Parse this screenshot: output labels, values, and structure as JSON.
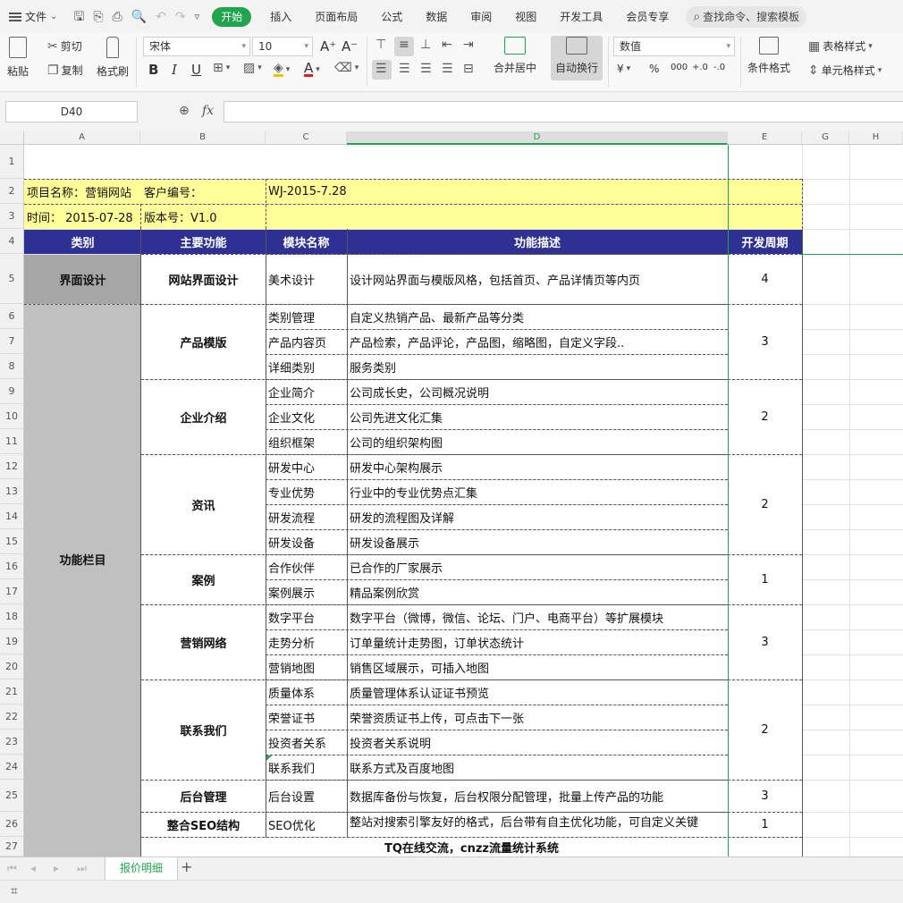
{
  "app": {
    "file_menu": "文件",
    "tabs": [
      "开始",
      "插入",
      "页面布局",
      "公式",
      "数据",
      "审阅",
      "视图",
      "开发工具",
      "会员专享"
    ],
    "search_placeholder": "查找命令、搜索模板"
  },
  "ribbon": {
    "paste": "粘贴",
    "cut": "剪切",
    "copy": "复制",
    "format_painter": "格式刷",
    "font_name": "宋体",
    "font_size": "10",
    "merge_center": "合并居中",
    "wrap_text": "自动换行",
    "number_format": "数值",
    "conditional_format": "条件格式",
    "table_style": "表格样式",
    "cell_style": "单元格样式",
    "bold": "B",
    "italic": "I",
    "underline": "U",
    "font_color": "A",
    "grow_font": "A⁺",
    "shrink_font": "A⁻",
    "currency": "¥",
    "percent": "%",
    "thousands": "000",
    "inc_decimal": "+.0",
    "dec_decimal": "-.0"
  },
  "formula_bar": {
    "cell_ref": "D40",
    "fx": "fx",
    "value": ""
  },
  "columns": [
    "A",
    "B",
    "C",
    "D",
    "E",
    "G",
    "H"
  ],
  "rows": [
    "1",
    "2",
    "3",
    "4",
    "5",
    "6",
    "7",
    "8",
    "9",
    "10",
    "11",
    "12",
    "13",
    "14",
    "15",
    "16",
    "17",
    "18",
    "19",
    "20",
    "21",
    "22",
    "23",
    "24",
    "25",
    "26",
    "27"
  ],
  "sheet": {
    "info": {
      "project": "项目名称：营销网站",
      "client": "客户编号：",
      "code": "WJ-2015-7.28",
      "date": "时间： 2015-07-28",
      "version": "版本号：V1.0"
    },
    "headers": [
      "类别",
      "主要功能",
      "模块名称",
      "功能描述",
      "开发周期"
    ],
    "categories": [
      "界面设计",
      "功能栏目"
    ],
    "main_functions": [
      "网站界面设计",
      "产品模版",
      "企业介绍",
      "资讯",
      "案例",
      "营销网络",
      "联系我们",
      "后台管理",
      "整合SEO结构"
    ],
    "modules": [
      {
        "name": "美术设计",
        "desc": "设计网站界面与模版风格，包括首页、产品详情页等内页"
      },
      {
        "name": "类别管理",
        "desc": "自定义热销产品、最新产品等分类"
      },
      {
        "name": "产品内容页",
        "desc": "产品检索，产品评论，产品图，缩略图，自定义字段.."
      },
      {
        "name": "详细类别",
        "desc": "服务类别"
      },
      {
        "name": "企业简介",
        "desc": "公司成长史，公司概况说明"
      },
      {
        "name": "企业文化",
        "desc": "公司先进文化汇集"
      },
      {
        "name": "组织框架",
        "desc": "公司的组织架构图"
      },
      {
        "name": "研发中心",
        "desc": "研发中心架构展示"
      },
      {
        "name": "专业优势",
        "desc": "行业中的专业优势点汇集"
      },
      {
        "name": "研发流程",
        "desc": "研发的流程图及详解"
      },
      {
        "name": "研发设备",
        "desc": "研发设备展示"
      },
      {
        "name": "合作伙伴",
        "desc": "已合作的厂家展示"
      },
      {
        "name": "案例展示",
        "desc": "精品案例欣赏"
      },
      {
        "name": "数字平台",
        "desc": "数字平台（微博，微信、论坛、门户、电商平台）等扩展模块"
      },
      {
        "name": "走势分析",
        "desc": "订单量统计走势图，订单状态统计"
      },
      {
        "name": "营销地图",
        "desc": "销售区域展示，可插入地图"
      },
      {
        "name": "质量体系",
        "desc": "质量管理体系认证证书预览"
      },
      {
        "name": "荣誉证书",
        "desc": "荣誉资质证书上传，可点击下一张"
      },
      {
        "name": "投资者关系",
        "desc": "投资者关系说明"
      },
      {
        "name": "联系我们",
        "desc": "联系方式及百度地图"
      },
      {
        "name": "后台设置",
        "desc": "数据库备份与恢复，后台权限分配管理，批量上传产品的功能"
      },
      {
        "name": "SEO优化",
        "desc": "整站对搜索引擎友好的格式，后台带有自主优化功能，可自定义关键"
      }
    ],
    "periods": [
      "4",
      "3",
      "2",
      "2",
      "1",
      "3",
      "2",
      "3",
      "1"
    ],
    "row27": "TQ在线交流，cnzz流量统计系统"
  },
  "sheet_tab": "报价明细",
  "colors": {
    "accent_green": "#21a44d",
    "header_blue": "#2e3192",
    "info_yellow": "#ffff99",
    "cat_gray": "#a6a6a6",
    "cat_lightgray": "#c0c0c0"
  }
}
